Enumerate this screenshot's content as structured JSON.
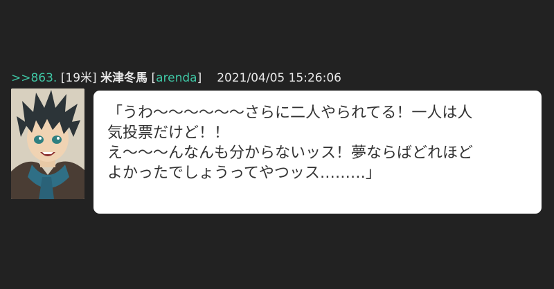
{
  "post": {
    "anchor": ">>863.",
    "count": "[19米]",
    "name": "米津冬馬",
    "trip_open": "[",
    "trip": "arenda",
    "trip_close": "]",
    "datetime": "2021/04/05 15:26:06",
    "message_lines": [
      "「うわ〜〜〜〜〜〜さらに二人やられてる！一人は人",
      "気投票だけど！！",
      "え〜〜〜んなんも分からないッス！夢ならばどれほど",
      "よかったでしょうってやつッス………」"
    ]
  },
  "colors": {
    "background": "#222222",
    "accent": "#3fc6a4",
    "bubble": "#ffffff",
    "text": "#333333"
  },
  "icons": {
    "avatar": "character-portrait"
  }
}
